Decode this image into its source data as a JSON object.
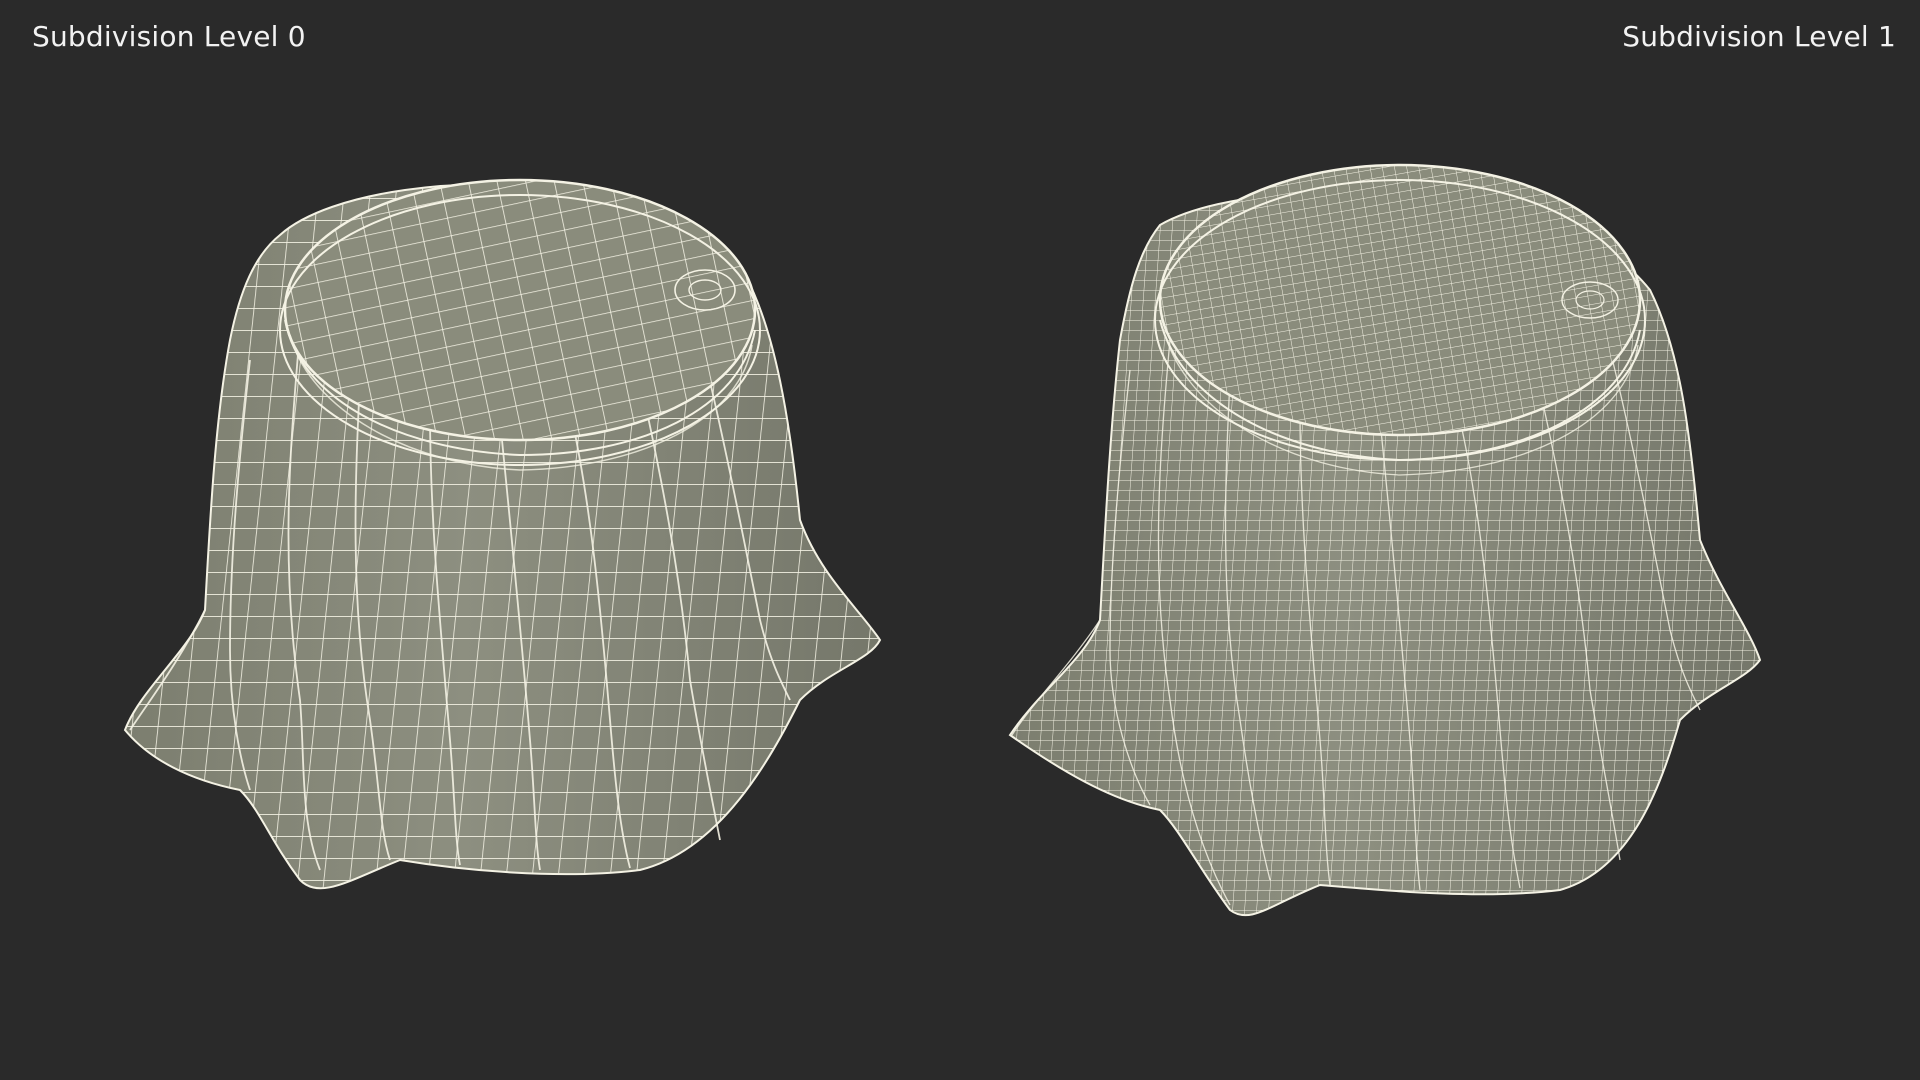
{
  "labels": {
    "left": "Subdivision Level 0",
    "right": "Subdivision Level 1"
  },
  "colors": {
    "background": "#2a2a2a",
    "surface": "#8a8c7c",
    "surface_dark": "#6d6f61",
    "wire": "#f4f2e4",
    "label_text": "#f2f2f2"
  }
}
